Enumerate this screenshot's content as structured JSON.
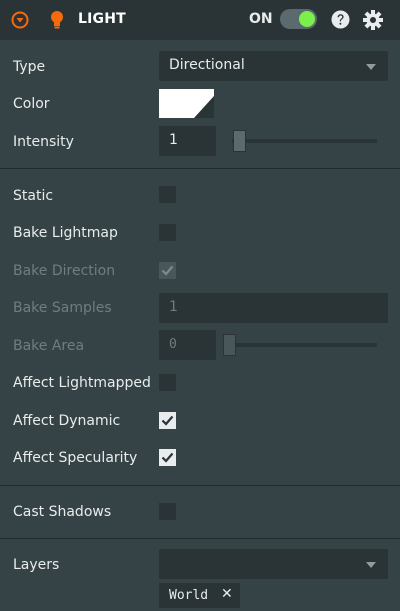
{
  "header": {
    "title": "LIGHT",
    "toggle_label": "ON",
    "toggle_state": "on",
    "accent_color": "#f46a0d",
    "toggle_color": "#7cf04a",
    "icons": [
      "collapse-icon",
      "lightbulb-icon",
      "help-icon",
      "gear-icon"
    ]
  },
  "fields": {
    "type": {
      "label": "Type",
      "value": "Directional",
      "icon": "chevron-down-icon"
    },
    "color": {
      "label": "Color",
      "value": "#ffffff"
    },
    "intensity": {
      "label": "Intensity",
      "value": "1",
      "slider_fraction": 0.0
    },
    "static": {
      "label": "Static",
      "checked": false
    },
    "bake_lightmap": {
      "label": "Bake Lightmap",
      "checked": false
    },
    "bake_direction": {
      "label": "Bake Direction",
      "checked": true,
      "disabled": true
    },
    "bake_samples": {
      "label": "Bake Samples",
      "value": "1",
      "disabled": true
    },
    "bake_area": {
      "label": "Bake Area",
      "value": "0",
      "slider_fraction": 0.0,
      "disabled": true
    },
    "affect_lightmapped": {
      "label": "Affect Lightmapped",
      "checked": false
    },
    "affect_dynamic": {
      "label": "Affect Dynamic",
      "checked": true
    },
    "affect_specularity": {
      "label": "Affect Specularity",
      "checked": true
    },
    "cast_shadows": {
      "label": "Cast Shadows",
      "checked": false
    },
    "layers": {
      "label": "Layers",
      "value": "",
      "tags": [
        {
          "label": "World",
          "remove": "✕"
        }
      ]
    }
  }
}
